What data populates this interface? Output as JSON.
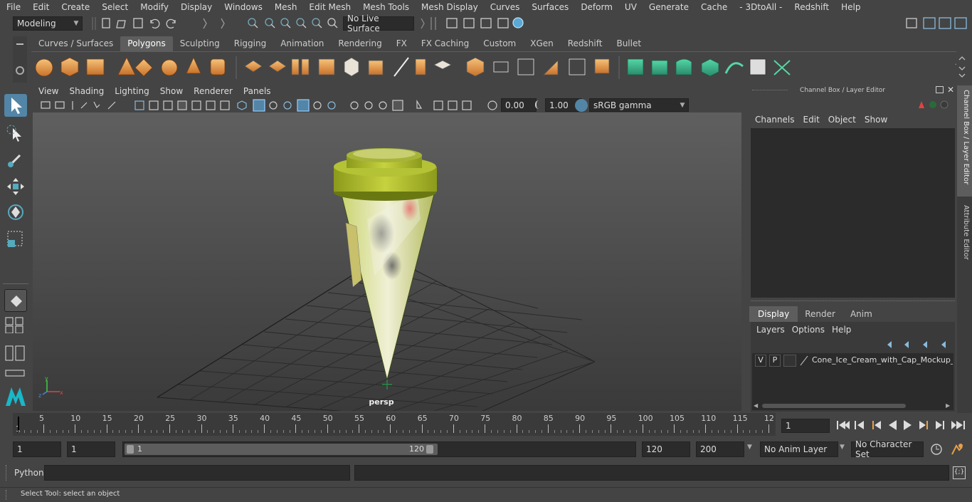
{
  "menu": [
    "File",
    "Edit",
    "Create",
    "Select",
    "Modify",
    "Display",
    "Windows",
    "Mesh",
    "Edit Mesh",
    "Mesh Tools",
    "Mesh Display",
    "Curves",
    "Surfaces",
    "Deform",
    "UV",
    "Generate",
    "Cache",
    "- 3DtoAll -",
    "Redshift",
    "Help"
  ],
  "workspace": {
    "mode": "Modeling",
    "live_surface": "No Live Surface"
  },
  "shelf_tabs": [
    "Curves / Surfaces",
    "Polygons",
    "Sculpting",
    "Rigging",
    "Animation",
    "Rendering",
    "FX",
    "FX Caching",
    "Custom",
    "XGen",
    "Redshift",
    "Bullet"
  ],
  "active_shelf_tab": "Polygons",
  "viewport": {
    "menu": [
      "View",
      "Shading",
      "Lighting",
      "Show",
      "Renderer",
      "Panels"
    ],
    "exposure": "0.00",
    "gamma": "1.00",
    "colorspace": "sRGB gamma",
    "camera_label": "persp"
  },
  "channel_box": {
    "title": "Channel Box / Layer Editor",
    "menu": [
      "Channels",
      "Edit",
      "Object",
      "Show"
    ]
  },
  "layer_editor": {
    "tabs": [
      "Display",
      "Render",
      "Anim"
    ],
    "active_tab": "Display",
    "menu": [
      "Layers",
      "Options",
      "Help"
    ],
    "layer": {
      "v": "V",
      "p": "P",
      "name": "Cone_Ice_Cream_with_Cap_Mockup_Pi"
    }
  },
  "side_tabs": [
    "Channel Box / Layer Editor",
    "Attribute Editor"
  ],
  "timeline": {
    "ticks": [
      "5",
      "10",
      "15",
      "20",
      "25",
      "30",
      "35",
      "40",
      "45",
      "50",
      "55",
      "60",
      "65",
      "70",
      "75",
      "80",
      "85",
      "90",
      "95",
      "100",
      "105",
      "110",
      "115",
      "12"
    ],
    "start_label": "1",
    "current_frame": "1"
  },
  "range": {
    "start": "1",
    "playback_start": "1",
    "slider_start": "1",
    "slider_end": "120",
    "playback_end": "120",
    "end": "200",
    "anim_layer": "No Anim Layer",
    "character_set": "No Character Set"
  },
  "command": {
    "label": "Python"
  },
  "help_text": "Select Tool: select an object",
  "colors": {
    "accent_blue": "#5285a6",
    "shelf_orange": "#e8a04a",
    "shelf_green": "#3fae8a",
    "model_green": "#b7c43a"
  }
}
